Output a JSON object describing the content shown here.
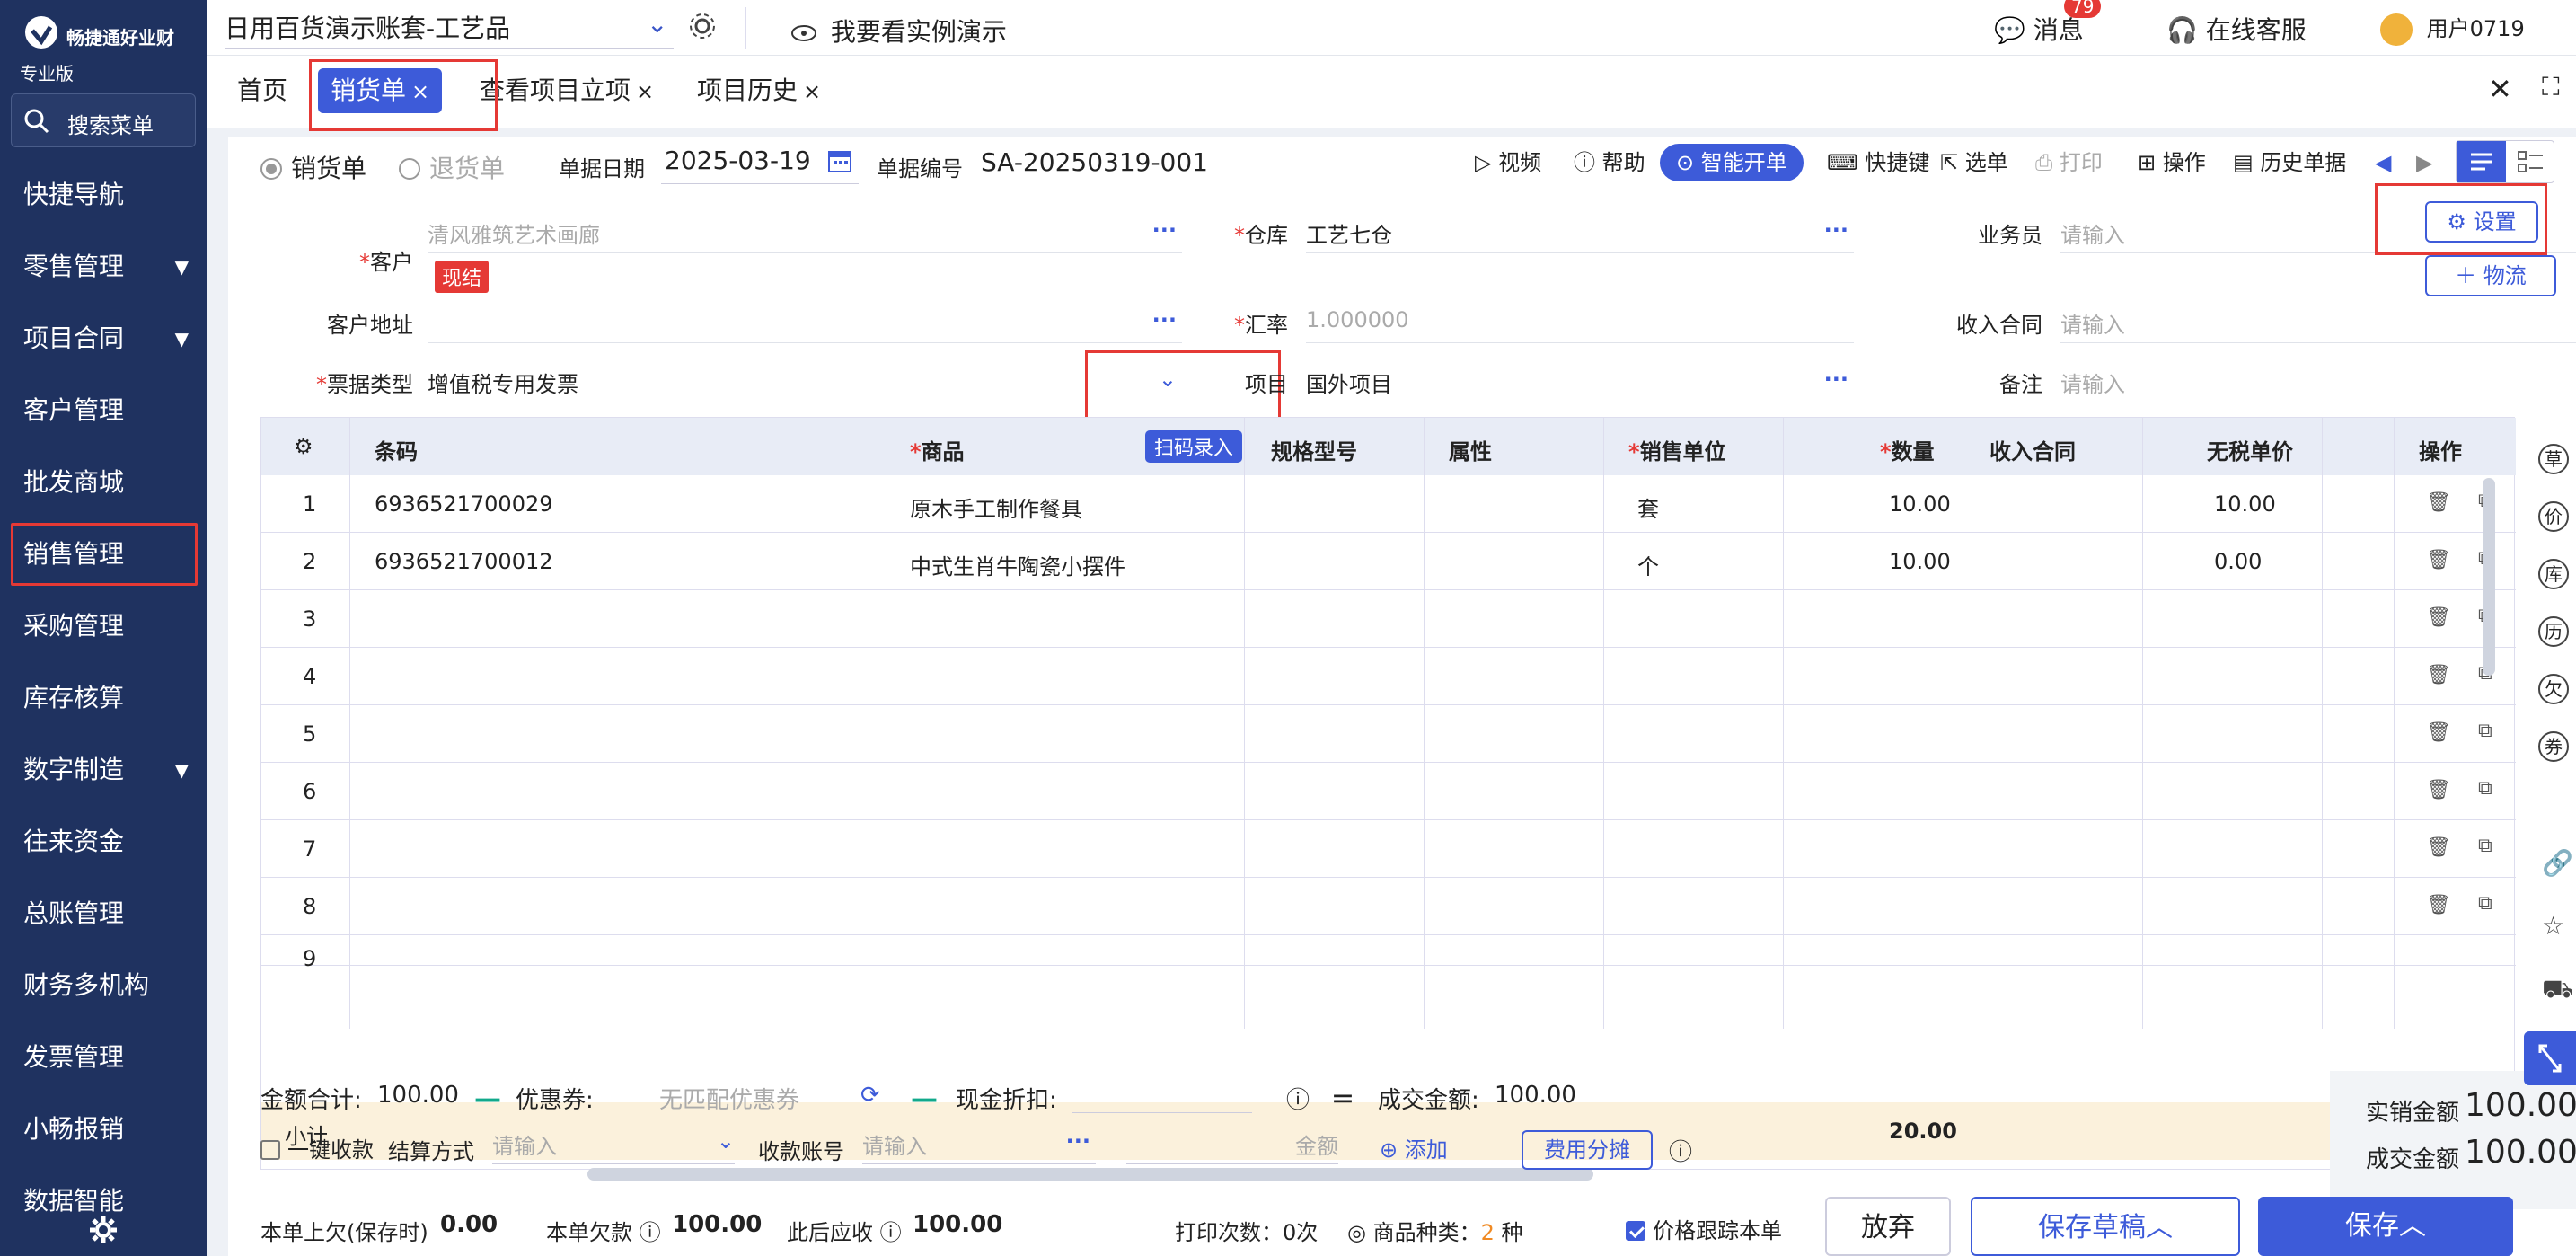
{
  "sidebar": {
    "brand": "畅捷通好业财",
    "edition": "专业版",
    "search_label": "搜索菜单",
    "items": [
      {
        "label": "快捷导航",
        "caret": false
      },
      {
        "label": "零售管理",
        "caret": true
      },
      {
        "label": "项目合同",
        "caret": true
      },
      {
        "label": "客户管理",
        "caret": false
      },
      {
        "label": "批发商城",
        "caret": false
      },
      {
        "label": "销售管理",
        "caret": false,
        "active": true
      },
      {
        "label": "采购管理",
        "caret": false
      },
      {
        "label": "库存核算",
        "caret": false
      },
      {
        "label": "数字制造",
        "caret": true
      },
      {
        "label": "往来资金",
        "caret": false
      },
      {
        "label": "总账管理",
        "caret": false
      },
      {
        "label": "财务多机构",
        "caret": false
      },
      {
        "label": "发票管理",
        "caret": false
      },
      {
        "label": "小畅报销",
        "caret": false
      },
      {
        "label": "数据智能",
        "caret": false
      }
    ]
  },
  "topbar": {
    "account": "日用百货演示账套-工艺品",
    "demo": "我要看实例演示",
    "messages": "消息",
    "messages_badge": "79",
    "service": "在线客服",
    "user": "用户0719"
  },
  "tabs": [
    {
      "label": "首页",
      "closable": false
    },
    {
      "label": "销货单",
      "closable": true,
      "active": true
    },
    {
      "label": "查看项目立项",
      "closable": true
    },
    {
      "label": "项目历史",
      "closable": true
    }
  ],
  "doc": {
    "type_sales": "销货单",
    "type_return": "退货单",
    "date_label": "单据日期",
    "date_value": "2025-03-19",
    "no_label": "单据编号",
    "no_value": "SA-20250319-001"
  },
  "toolbar": {
    "video": "视频",
    "help": "帮助",
    "smart": "智能开单",
    "shortcut": "快捷键",
    "select": "选单",
    "print": "打印",
    "operate": "操作",
    "history": "历史单据"
  },
  "form": {
    "customer_label": "客户",
    "customer_value": "清风雅筑艺术画廊",
    "customer_tag": "现结",
    "warehouse_label": "仓库",
    "warehouse_value": "工艺七仓",
    "salesman_label": "业务员",
    "salesman_ph": "请输入",
    "address_label": "客户地址",
    "rate_label": "汇率",
    "rate_value": "1.000000",
    "income_contract_label": "收入合同",
    "income_contract_ph": "请输入",
    "invoice_type_label": "票据类型",
    "invoice_type_value": "增值税专用发票",
    "project_label": "项目",
    "project_value": "国外项目",
    "remark_label": "备注",
    "remark_ph": "请输入",
    "settings_btn": "设置",
    "logistics_btn": "物流"
  },
  "table": {
    "headers": {
      "barcode": "条码",
      "product": "商品",
      "scan": "扫码录入",
      "spec": "规格型号",
      "attr": "属性",
      "unit": "销售单位",
      "qty": "数量",
      "contract": "收入合同",
      "price": "无税单价",
      "ops": "操作"
    },
    "rows": [
      {
        "no": "1",
        "barcode": "6936521700029",
        "product": "原木手工制作餐具",
        "unit": "套",
        "qty": "10.00",
        "price": "10.00"
      },
      {
        "no": "2",
        "barcode": "6936521700012",
        "product": "中式生肖牛陶瓷小摆件",
        "unit": "个",
        "qty": "10.00",
        "price": "0.00"
      },
      {
        "no": "3",
        "barcode": "",
        "product": "",
        "unit": "",
        "qty": "",
        "price": ""
      },
      {
        "no": "4",
        "barcode": "",
        "product": "",
        "unit": "",
        "qty": "",
        "price": ""
      },
      {
        "no": "5",
        "barcode": "",
        "product": "",
        "unit": "",
        "qty": "",
        "price": ""
      },
      {
        "no": "6",
        "barcode": "",
        "product": "",
        "unit": "",
        "qty": "",
        "price": ""
      },
      {
        "no": "7",
        "barcode": "",
        "product": "",
        "unit": "",
        "qty": "",
        "price": ""
      },
      {
        "no": "8",
        "barcode": "",
        "product": "",
        "unit": "",
        "qty": "",
        "price": ""
      },
      {
        "no": "9",
        "barcode": "",
        "product": "",
        "unit": "",
        "qty": "",
        "price": ""
      }
    ],
    "subtotal_label": "小计",
    "subtotal_qty": "20.00"
  },
  "summary": {
    "total_label": "金额合计:",
    "total_value": "100.00",
    "coupon_label": "优惠券:",
    "coupon_value": "无匹配优惠券",
    "cash_discount_label": "现金折扣:",
    "deal_label": "成交金额:",
    "deal_value": "100.00",
    "real_sales_label": "实销金额",
    "real_sales_value": "100.00",
    "deal_amount_label": "成交金额",
    "deal_amount_value": "100.00",
    "one_click": "一键收款",
    "settle_label": "结算方式",
    "settle_ph": "请输入",
    "account_label": "收款账号",
    "account_ph": "请输入",
    "amount_ph": "金额",
    "add": "添加",
    "fee_split": "费用分摊"
  },
  "footer": {
    "prev_debt_label": "本单上欠(保存时)",
    "prev_debt_value": "0.00",
    "debt_label": "本单欠款",
    "debt_value": "100.00",
    "receivable_label": "此后应收",
    "receivable_value": "100.00",
    "print_count": "打印次数：0次",
    "kinds_label": "商品种类：",
    "kinds_value": "2",
    "kinds_unit": "种",
    "track_price": "价格跟踪本单",
    "discard": "放弃",
    "save_draft": "保存草稿",
    "save": "保存"
  },
  "right_rail": [
    "草",
    "价",
    "库",
    "历",
    "欠",
    "券"
  ],
  "colors": {
    "primary": "#3d5bd9",
    "sidebar": "#1f3260",
    "highlight": "#e53935",
    "subtotal_bg": "#fbf1dc"
  }
}
